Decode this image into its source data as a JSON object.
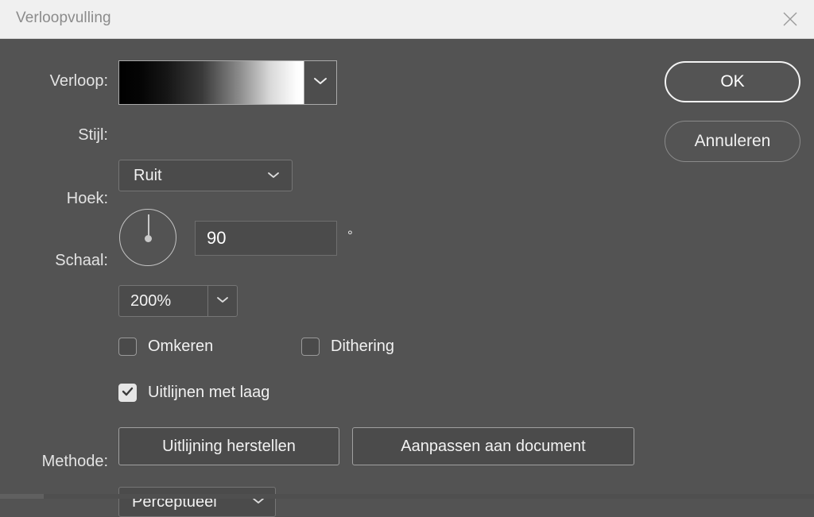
{
  "window": {
    "title": "Verloopvulling",
    "close_icon": "close-icon"
  },
  "labels": {
    "gradient": "Verloop:",
    "style": "Stijl:",
    "angle": "Hoek:",
    "scale": "Schaal:",
    "method": "Methode:"
  },
  "fields": {
    "gradient": {
      "preview": "black-to-white",
      "dropdown_icon": "chevron-down-icon"
    },
    "style": {
      "value": "Ruit",
      "dropdown_icon": "chevron-down-icon"
    },
    "angle": {
      "value": "90",
      "unit": "°",
      "dial_icon": "angle-dial"
    },
    "scale": {
      "value": "200%",
      "dropdown_icon": "chevron-down-icon"
    },
    "method": {
      "value": "Perceptueel",
      "dropdown_icon": "chevron-down-icon"
    }
  },
  "checkboxes": {
    "reverse": {
      "label": "Omkeren",
      "checked": false
    },
    "dither": {
      "label": "Dithering",
      "checked": false
    },
    "align_with_layer": {
      "label": "Uitlijnen met laag",
      "checked": true
    }
  },
  "buttons": {
    "reset_alignment": "Uitlijning herstellen",
    "fit_to_document": "Aanpassen aan document",
    "ok": "OK",
    "cancel": "Annuleren"
  },
  "colors": {
    "dialog_background": "#535353",
    "titlebar_background": "#f0f0f0",
    "titlebar_text": "#8b8b8b",
    "field_background": "#4b4b4b",
    "text": "#f2f2f2",
    "border": "#757575",
    "accent_border": "#f3f3f3"
  }
}
